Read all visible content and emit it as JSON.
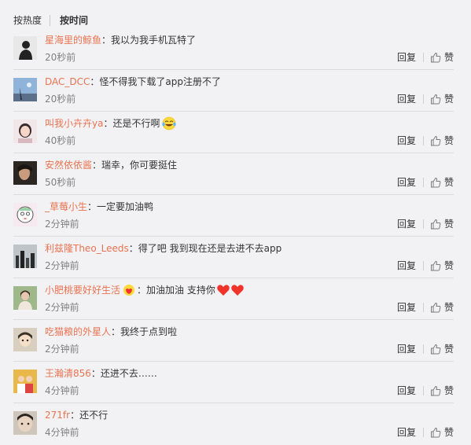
{
  "tabs": {
    "hot": "按热度",
    "time": "按时间"
  },
  "actions": {
    "reply": "回复",
    "like": "赞"
  },
  "colors": {
    "username": "#eb7350",
    "text": "#333333",
    "time": "#808080",
    "background": "#f2f2f5"
  },
  "comments": [
    {
      "user": "星海里的鲸鱼",
      "text": "我以为我手机瓦特了",
      "time": "20秒前",
      "emoji": "",
      "avatar": "silhouette-avatar"
    },
    {
      "user": "DAC_DCC",
      "text": "怪不得我下载了app注册不了",
      "time": "20秒前",
      "emoji": "",
      "avatar": "landscape-avatar"
    },
    {
      "user": "叫我小卉卉ya",
      "text": "还是不行啊",
      "time": "40秒前",
      "emoji": "laugh-cry-emoji",
      "avatar": "girl-avatar"
    },
    {
      "user": "安然依依酱",
      "text": "瑞幸，你可要挺住",
      "time": "50秒前",
      "emoji": "",
      "avatar": "dark-portrait-avatar"
    },
    {
      "user": "_草莓小生",
      "text": "一定要加油鸭",
      "time": "2分钟前",
      "emoji": "",
      "avatar": "cartoon-avatar"
    },
    {
      "user": "利兹隆Theo_Leeds",
      "text": "得了吧 我到现在还是去进不去app",
      "time": "2分钟前",
      "emoji": "",
      "avatar": "city-avatar"
    },
    {
      "user": "小肥桃要好好生活",
      "text": "加油加油 支持你",
      "time": "2分钟前",
      "emoji": "hearts-emoji",
      "avatar": "photo-avatar"
    },
    {
      "user": "吃猫粮的外星人",
      "text": "我终于点到啦",
      "time": "2分钟前",
      "emoji": "",
      "avatar": "anime-avatar"
    },
    {
      "user": "王瀚清856",
      "text": "还进不去……",
      "time": "4分钟前",
      "emoji": "",
      "avatar": "group-avatar"
    },
    {
      "user": "271fr",
      "text": "还不行",
      "time": "4分钟前",
      "emoji": "",
      "avatar": "face-avatar"
    }
  ]
}
